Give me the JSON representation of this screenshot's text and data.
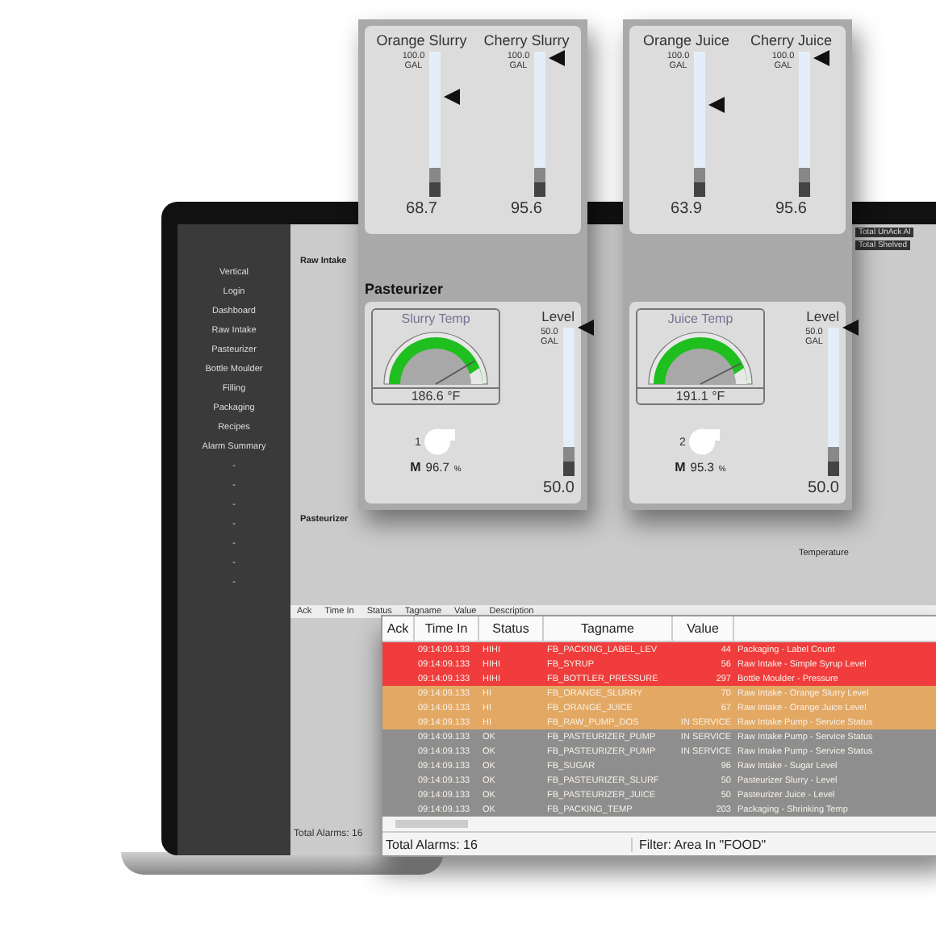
{
  "laptop": {
    "sidebar": {
      "items": [
        {
          "label": "Vertical"
        },
        {
          "label": "Login"
        },
        {
          "label": "Dashboard"
        },
        {
          "label": "Raw Intake"
        },
        {
          "label": "Pasteurizer"
        },
        {
          "label": "Bottle Moulder"
        },
        {
          "label": "Filling"
        },
        {
          "label": "Packaging"
        },
        {
          "label": "Recipes"
        },
        {
          "label": "Alarm Summary"
        },
        {
          "label": "-"
        },
        {
          "label": "-"
        },
        {
          "label": "-"
        },
        {
          "label": "-"
        },
        {
          "label": "-"
        },
        {
          "label": "-"
        },
        {
          "label": "-"
        }
      ]
    },
    "panel_labels": [
      "Raw Intake",
      "Pasteurizer",
      "Temperature"
    ],
    "totals": [
      "Total UnAck Al",
      "Total Shelved"
    ],
    "alarm_columns": [
      "Ack",
      "Time In",
      "Status",
      "Tagname",
      "Value",
      "Description"
    ],
    "alarm_total": "Total Alarms: 16"
  },
  "popups": [
    {
      "tanks": [
        {
          "name": "Orange Slurry",
          "max": "100.0",
          "unit": "GAL",
          "level": 0.687,
          "reading": "68.7"
        },
        {
          "name": "Cherry Slurry",
          "max": "100.0",
          "unit": "GAL",
          "level": 0.956,
          "reading": "95.6"
        }
      ],
      "section": "Pasteurizer",
      "gauge": {
        "title": "Slurry Temp",
        "level": 0.83,
        "reading": "186.6 °F"
      },
      "pump": {
        "number": "1",
        "mode": "M",
        "reading": "96.7",
        "unit": "%"
      },
      "level_tank": {
        "title": "Level",
        "max": "50.0",
        "unit": "GAL",
        "level": 1,
        "reading": "50.0"
      }
    },
    {
      "tanks": [
        {
          "name": "Orange Juice",
          "max": "100.0",
          "unit": "GAL",
          "level": 0.639,
          "reading": "63.9"
        },
        {
          "name": "Cherry Juice",
          "max": "100.0",
          "unit": "GAL",
          "level": 0.956,
          "reading": "95.6"
        }
      ],
      "gauge": {
        "title": "Juice Temp",
        "level": 0.85,
        "reading": "191.1 °F"
      },
      "pump": {
        "number": "2",
        "mode": "M",
        "reading": "95.3",
        "unit": "%"
      },
      "level_tank": {
        "title": "Level",
        "max": "50.0",
        "unit": "GAL",
        "level": 1,
        "reading": "50.0"
      }
    }
  ],
  "alarms": {
    "columns": [
      "Ack",
      "Time In",
      "Status",
      "Tagname",
      "Value"
    ],
    "rows": [
      {
        "time": "09:14:09.133",
        "status": "HIHI",
        "tagname": "FB_PACKING_LABEL_LEV",
        "value": "44",
        "description": "Packaging - Label Count",
        "color": "#f03c3c"
      },
      {
        "time": "09:14:09.133",
        "status": "HIHI",
        "tagname": "FB_SYRUP",
        "value": "56",
        "description": "Raw Intake - Simple Syrup Level",
        "color": "#f03c3c"
      },
      {
        "time": "09:14:09.133",
        "status": "HIHI",
        "tagname": "FB_BOTTLER_PRESSURE",
        "value": "297",
        "description": "Bottle Moulder - Pressure",
        "color": "#f03c3c"
      },
      {
        "time": "09:14:09.133",
        "status": "HI",
        "tagname": "FB_ORANGE_SLURRY",
        "value": "70",
        "description": "Raw Intake - Orange Slurry Level",
        "color": "#e3a863"
      },
      {
        "time": "09:14:09.133",
        "status": "HI",
        "tagname": "FB_ORANGE_JUICE",
        "value": "67",
        "description": "Raw Intake - Orange Juice Level",
        "color": "#e3a863"
      },
      {
        "time": "09:14:09.133",
        "status": "HI",
        "tagname": "FB_RAW_PUMP_DOS",
        "value": "IN SERVICE",
        "description": "Raw Intake Pump - Service Status",
        "color": "#e3a863"
      },
      {
        "time": "09:14:09.133",
        "status": "OK",
        "tagname": "FB_PASTEURIZER_PUMP",
        "value": "IN SERVICE",
        "description": "Raw Intake Pump - Service Status",
        "color": "#8e8e8e"
      },
      {
        "time": "09:14:09.133",
        "status": "OK",
        "tagname": "FB_PASTEURIZER_PUMP",
        "value": "IN SERVICE",
        "description": "Raw Intake Pump - Service Status",
        "color": "#8e8e8e"
      },
      {
        "time": "09:14:09.133",
        "status": "OK",
        "tagname": "FB_SUGAR",
        "value": "96",
        "description": "Raw Intake - Sugar Level",
        "color": "#8e8e8e"
      },
      {
        "time": "09:14:09.133",
        "status": "OK",
        "tagname": "FB_PASTEURIZER_SLURF",
        "value": "50",
        "description": "Pasteurizer Slurry - Level",
        "color": "#8e8e8e"
      },
      {
        "time": "09:14:09.133",
        "status": "OK",
        "tagname": "FB_PASTEURIZER_JUICE",
        "value": "50",
        "description": "Pasteurizer Juice - Level",
        "color": "#8e8e8e"
      },
      {
        "time": "09:14:09.133",
        "status": "OK",
        "tagname": "FB_PACKING_TEMP",
        "value": "203",
        "description": "Packaging - Shrinking Temp",
        "color": "#8e8e8e"
      }
    ],
    "total": "Total Alarms: 16",
    "filter": "Filter: Area In \"FOOD\""
  }
}
